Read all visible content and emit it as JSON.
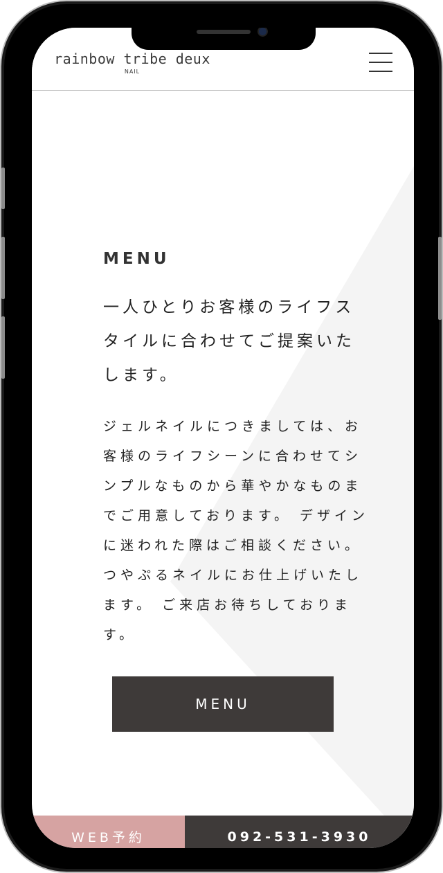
{
  "header": {
    "logo_main": "rainbow tribe deux",
    "logo_sub": "NAIL"
  },
  "menu_section": {
    "title": "MENU",
    "lead_lines": [
      "一人ひとりお客様のライフス",
      "タイルに合わせてご提案いた",
      "します。"
    ],
    "body_lines": [
      "ジェルネイルにつきましては、お",
      "客様のライフシーンに合わせてシ",
      "ンプルなものから華やかなものま",
      "でご用意しております。 デザイン",
      "に迷われた際はご相談ください。",
      "つやぷるネイルにお仕上げいたし",
      "ます。 ご来店お待ちしておりま",
      "す。"
    ],
    "button_label": "MENU"
  },
  "footer": {
    "web_reserve_label": "WEB予約",
    "phone_label": "092-531-3930"
  },
  "icons": {
    "menu": "hamburger-menu-icon"
  },
  "colors": {
    "button_dark": "#3e3a39",
    "accent_pink": "#d6a3a2"
  }
}
